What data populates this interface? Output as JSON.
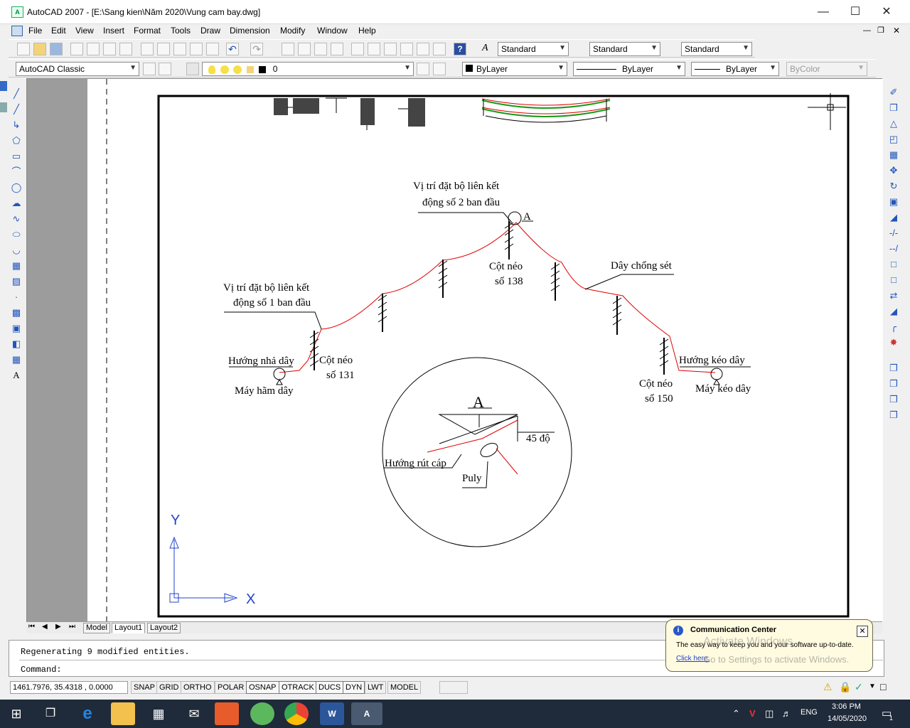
{
  "window": {
    "title": "AutoCAD 2007 - [E:\\Sang kien\\Năm 2020\\Vung cam bay.dwg]"
  },
  "menu": [
    "File",
    "Edit",
    "View",
    "Insert",
    "Format",
    "Tools",
    "Draw",
    "Dimension",
    "Modify",
    "Window",
    "Help"
  ],
  "toolbar1": {
    "text_style": "Standard",
    "dim_style": "Standard",
    "table_style": "Standard"
  },
  "toolbar2": {
    "workspace": "AutoCAD Classic",
    "layer": "0",
    "color": "ByLayer",
    "linetype": "ByLayer",
    "lineweight": "ByLayer",
    "plotstyle": "ByColor"
  },
  "drawing": {
    "label_bo_lien_ket_2_l1": "Vị trí đặt bộ liên kết",
    "label_bo_lien_ket_2_l2": "động số 2 ban đầu",
    "label_A_small": "A",
    "label_cot_138_l1": "Cột néo",
    "label_cot_138_l2": "số 138",
    "label_day_chong_set": "Dây chống sét",
    "label_bo_lien_ket_1_l1": "Vị trí đặt bộ liên kết",
    "label_bo_lien_ket_1_l2": "động số 1 ban đầu",
    "label_huong_nha_day": "Hướng nhả dây",
    "label_may_ham_day": "Máy hãm dây",
    "label_cot_131_l1": "Cột néo",
    "label_cot_131_l2": "số 131",
    "label_huong_keo_day": "Hướng kéo dây",
    "label_may_keo_day": "Máy kéo dây",
    "label_cot_150_l1": "Cột néo",
    "label_cot_150_l2": "số 150",
    "label_A_big": "A",
    "label_45_do": "45 độ",
    "label_huong_rut_cap": "Hướng rút cáp",
    "label_puly": "Puly",
    "ucs_y": "Y",
    "ucs_x": "X"
  },
  "tabs": [
    "Model",
    "Layout1",
    "Layout2"
  ],
  "active_tab": "Layout1",
  "command": {
    "history": "Regenerating 9 modified entities.",
    "prompt": "Command:"
  },
  "status": {
    "coords": "1461.7976, 35.4318  , 0.0000",
    "buttons": [
      "SNAP",
      "GRID",
      "ORTHO",
      "POLAR",
      "OSNAP",
      "OTRACK",
      "DUCS",
      "DYN",
      "LWT",
      "MODEL"
    ]
  },
  "popup": {
    "title": "Communication Center",
    "body": "The easy way to keep you and your software up-to-date.",
    "link": "Click here.",
    "watermark_1": "Activate Windows",
    "watermark_2": "Go to Settings to activate Windows."
  },
  "taskbar": {
    "lang": "ENG",
    "time": "3:06 PM",
    "date": "14/05/2020",
    "notify_count": "1"
  },
  "colors": {
    "wire": "#e00000",
    "ucs": "#2244cc",
    "taskbar": "#1f2a3a"
  }
}
